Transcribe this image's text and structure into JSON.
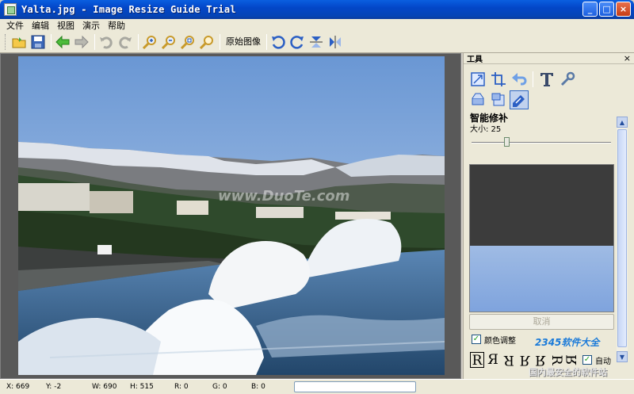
{
  "window": {
    "title": "Yalta.jpg - Image Resize Guide Trial"
  },
  "menu": [
    "文件",
    "编辑",
    "视图",
    "演示",
    "帮助"
  ],
  "toolbar": {
    "original_image_label": "原始图像",
    "icons": [
      "open-folder-icon",
      "save-icon",
      "back-arrow-icon",
      "forward-arrow-icon",
      "undo-icon",
      "redo-icon",
      "zoom-in-icon",
      "zoom-out-icon",
      "zoom-fit-icon",
      "zoom-actual-icon",
      "rotate-left-icon",
      "rotate-right-icon",
      "flip-vertical-icon",
      "flip-horizontal-icon"
    ]
  },
  "panel": {
    "title": "工具",
    "close": "×",
    "section_title": "智能修补",
    "size_label": "大小: 25",
    "size_value": 25,
    "cancel_label": "取消",
    "color_adjust_label": "颜色调整",
    "color_adjust_checked": true,
    "auto_label": "自动",
    "auto_checked": true,
    "glyphs": [
      "R",
      "Я",
      "Я",
      "R",
      "Я",
      "R",
      "Я"
    ]
  },
  "photo": {
    "watermark": "www.DuoTe.com"
  },
  "site_watermark": {
    "logo": "2345软件大全",
    "slogan": "国内最安全的软件站"
  },
  "status": {
    "x": "X: 669",
    "y": "Y: -2",
    "w": "W: 690",
    "h": "H: 515",
    "r": "R: 0",
    "g": "G: 0",
    "b": "B: 0"
  }
}
